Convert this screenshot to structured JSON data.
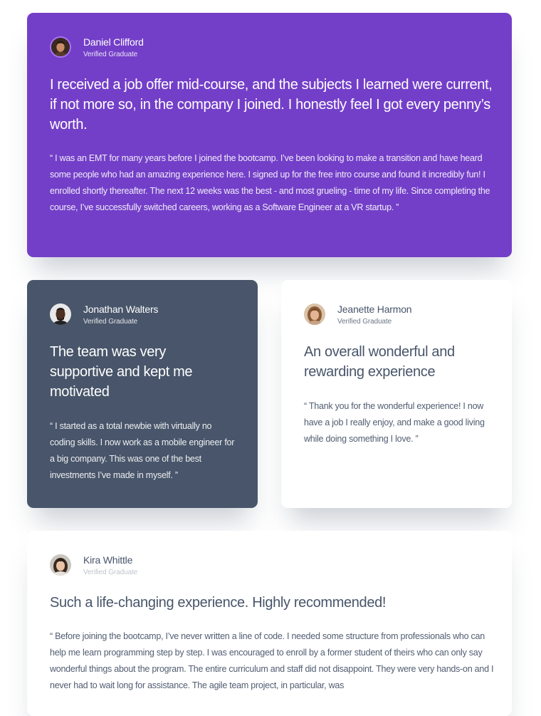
{
  "testimonials": [
    {
      "name": "Daniel Clifford",
      "badge": "Verified Graduate",
      "avatar": "avatar-daniel",
      "headline": "I received a job offer mid-course, and the subjects I learned were current, if not more so, in the company I joined. I honestly feel I got every penny’s worth.",
      "quote": "“ I was an EMT for many years before I joined the bootcamp. I’ve been looking to make a transition and have heard some people who had an amazing experience here. I signed up for the free intro course and found it incredibly fun! I enrolled shortly thereafter. The next 12 weeks was the best - and most grueling - time of my life. Since completing the course, I’ve successfully switched careers, working as a Software Engineer at a VR startup. ”"
    },
    {
      "name": "Jonathan Walters",
      "badge": "Verified Graduate",
      "avatar": "avatar-jonathan",
      "headline": "The team was very supportive and kept me motivated",
      "quote": "“ I started as a total newbie with virtually no coding skills. I now work as a mobile engineer for a big company. This was one of the best investments I’ve made in myself. ”"
    },
    {
      "name": "Jeanette Harmon",
      "badge": "Verified Graduate",
      "avatar": "avatar-jeanette",
      "headline": "An overall wonderful and rewarding experience",
      "quote": "“ Thank you for the wonderful experience! I now have a job I really enjoy, and make a good living while doing something I love. ”"
    },
    {
      "name": "Kira Whittle",
      "badge": "Verified Graduate",
      "avatar": "avatar-kira",
      "headline": "Such a life-changing experience. Highly recommended!",
      "quote": "“ Before joining the bootcamp, I’ve never written a line of code. I needed some structure from professionals who can help me learn programming step by step. I was encouraged to enroll by a former student of theirs who can only say wonderful things about the program. The entire curriculum and staff did not disappoint. They were very hands-on and I never had to wait long for assistance. The agile team project, in particular, was"
    }
  ],
  "colors": {
    "purple": "#733fc8",
    "slate": "#48556a",
    "white": "#ffffff",
    "avatar_ring": "#a775f1"
  }
}
